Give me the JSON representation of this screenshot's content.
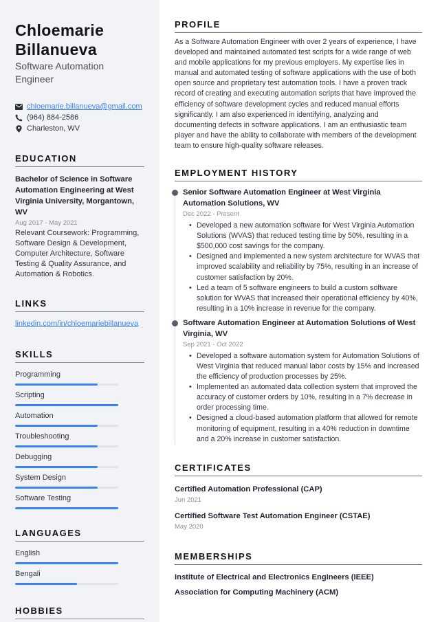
{
  "header": {
    "name_line1": "Chloemarie",
    "name_line2": "Billanueva",
    "title_line1": "Software Automation",
    "title_line2": "Engineer"
  },
  "contact": {
    "email": "chloemarie.billanueva@gmail.com",
    "phone": "(964) 884-2586",
    "location": "Charleston, WV",
    "icons": [
      "envelope-icon",
      "phone-icon",
      "map-pin-icon"
    ]
  },
  "education": {
    "heading": "EDUCATION",
    "degree": "Bachelor of Science in Software Automation Engineering at West Virginia University, Morgantown, WV",
    "dates": "Aug 2017 - May 2021",
    "coursework": "Relevant Coursework: Programming, Software Design & Development, Computer Architecture, Software Testing & Quality Assurance, and Automation & Robotics."
  },
  "links": {
    "heading": "LINKS",
    "items": [
      "linkedin.com/in/chloemariebillanueva"
    ]
  },
  "skills": {
    "heading": "SKILLS",
    "items": [
      {
        "name": "Programming",
        "level": 0.8
      },
      {
        "name": "Scripting",
        "level": 1.0
      },
      {
        "name": "Automation",
        "level": 0.8
      },
      {
        "name": "Troubleshooting",
        "level": 0.8
      },
      {
        "name": "Debugging",
        "level": 0.8
      },
      {
        "name": "System Design",
        "level": 0.8
      },
      {
        "name": "Software Testing",
        "level": 1.0
      }
    ]
  },
  "languages": {
    "heading": "LANGUAGES",
    "items": [
      {
        "name": "English",
        "level": 1.0
      },
      {
        "name": "Bengali",
        "level": 0.6
      }
    ]
  },
  "hobbies": {
    "heading": "HOBBIES"
  },
  "profile": {
    "heading": "PROFILE",
    "text": "As a Software Automation Engineer with over 2 years of experience, I have developed and maintained automated test scripts for a wide range of web and mobile applications for my previous employers. My expertise lies in manual and automated testing of software applications with the use of both open source and proprietary test automation tools. I have a proven track record of creating and executing automation scripts that have improved the efficiency of software development cycles and reduced manual efforts significantly. I am also experienced in identifying, analyzing and documenting defects in software applications. I am an enthusiastic team player and have the ability to collaborate with members of the development team to ensure high-quality software releases."
  },
  "employment": {
    "heading": "EMPLOYMENT HISTORY",
    "jobs": [
      {
        "title": "Senior Software Automation Engineer at West Virginia Automation Solutions, WV",
        "dates": "Dec 2022 - Present",
        "bullets": [
          "Developed a new automation software for West Virginia Automation Solutions (WVAS) that reduced testing time by 50%, resulting in a $500,000 cost savings for the company.",
          "Designed and implemented a new system architecture for WVAS that improved scalability and reliability by 75%, resulting in an increase of customer satisfaction by 20%.",
          "Led a team of 5 software engineers to build a custom software solution for WVAS that increased their operational efficiency by 40%, resulting in a 10% increase in revenue for the company."
        ]
      },
      {
        "title": "Software Automation Engineer at Automation Solutions of West Virginia, WV",
        "dates": "Sep 2021 - Oct 2022",
        "bullets": [
          "Developed a software automation system for Automation Solutions of West Virginia that reduced manual labor costs by 15% and increased the efficiency of production processes by 25%.",
          "Implemented an automated data collection system that improved the accuracy of customer orders by 10%, resulting in a 7% decrease in order processing time.",
          "Designed a cloud-based automation platform that allowed for remote monitoring of equipment, resulting in a 40% reduction in downtime and a 20% increase in customer satisfaction."
        ]
      }
    ]
  },
  "certificates": {
    "heading": "CERTIFICATES",
    "items": [
      {
        "name": "Certified Automation Professional (CAP)",
        "date": "Jun 2021"
      },
      {
        "name": "Certified Software Test Automation Engineer (CSTAE)",
        "date": "May 2020"
      }
    ]
  },
  "memberships": {
    "heading": "MEMBERSHIPS",
    "items": [
      "Institute of Electrical and Electronics Engineers (IEEE)",
      "Association for Computing Machinery (ACM)"
    ]
  },
  "colors": {
    "accent": "#3b82f6",
    "sidebar_bg": "#f2f3f6",
    "text": "#1f2330",
    "muted": "#8b8f96"
  }
}
